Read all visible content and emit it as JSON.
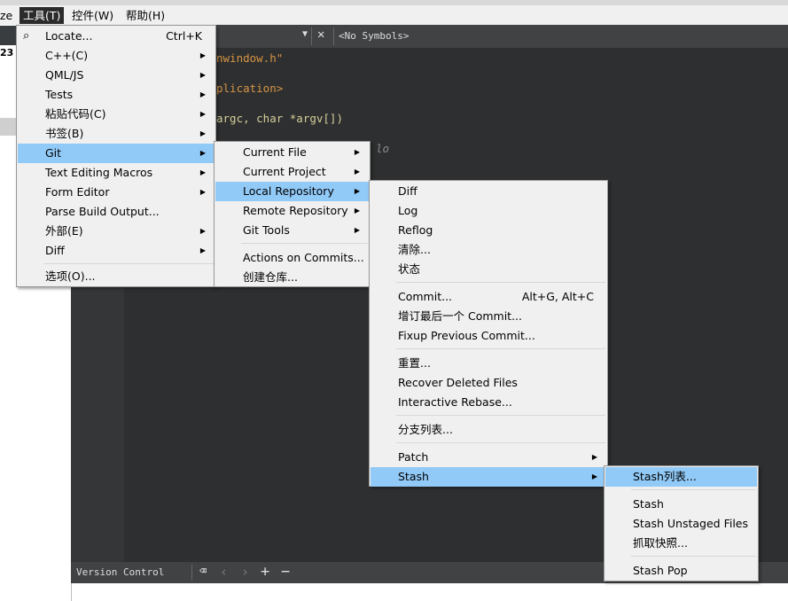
{
  "menubar": {
    "items": [
      {
        "label": "ze"
      },
      {
        "label": "工具(T)"
      },
      {
        "label": "控件(W)"
      },
      {
        "label": "帮助(H)"
      }
    ]
  },
  "left": {
    "text": "23"
  },
  "editor": {
    "symbols": "<No Symbols>",
    "code_lines": [
      "nwindow.h\"",
      "plication>",
      "argc, char *argv[])",
      "lo"
    ]
  },
  "output": {
    "tab": "Version Control"
  },
  "tools_menu": {
    "items": [
      {
        "label": "Locate...",
        "shortcut": "Ctrl+K",
        "submenu": false
      },
      {
        "label": "C++(C)",
        "submenu": true
      },
      {
        "label": "QML/JS",
        "submenu": true
      },
      {
        "label": "Tests",
        "submenu": true
      },
      {
        "label": "粘贴代码(C)",
        "submenu": true
      },
      {
        "label": "书签(B)",
        "submenu": true
      },
      {
        "label": "Git",
        "submenu": true,
        "highlighted": true
      },
      {
        "label": "Text Editing Macros",
        "submenu": true
      },
      {
        "label": "Form Editor",
        "submenu": true
      },
      {
        "label": "Parse Build Output...",
        "submenu": false
      },
      {
        "label": "外部(E)",
        "submenu": true
      },
      {
        "label": "Diff",
        "submenu": true
      },
      {
        "label": "选项(O)...",
        "submenu": false
      }
    ]
  },
  "git_menu": {
    "items": [
      {
        "label": "Current File"
      },
      {
        "label": "Current Project"
      },
      {
        "label": "Local Repository",
        "highlighted": true
      },
      {
        "label": "Remote Repository"
      },
      {
        "label": "Git Tools"
      },
      {
        "label": "Actions on Commits..."
      },
      {
        "label": "创建仓库..."
      }
    ]
  },
  "local_repo_menu": {
    "items": [
      {
        "label": "Diff"
      },
      {
        "label": "Log"
      },
      {
        "label": "Reflog"
      },
      {
        "label": "清除..."
      },
      {
        "label": "状态"
      },
      {
        "label": "Commit...",
        "shortcut": "Alt+G, Alt+C"
      },
      {
        "label": "增订最后一个 Commit..."
      },
      {
        "label": "Fixup Previous Commit..."
      },
      {
        "label": "重置..."
      },
      {
        "label": "Recover Deleted Files"
      },
      {
        "label": "Interactive Rebase..."
      },
      {
        "label": "分支列表..."
      },
      {
        "label": "Patch"
      },
      {
        "label": "Stash",
        "highlighted": true
      }
    ]
  },
  "stash_menu": {
    "items": [
      {
        "label": "Stash列表...",
        "highlighted": true
      },
      {
        "label": "Stash"
      },
      {
        "label": "Stash Unstaged Files"
      },
      {
        "label": "抓取快照..."
      },
      {
        "label": "Stash Pop"
      }
    ]
  }
}
